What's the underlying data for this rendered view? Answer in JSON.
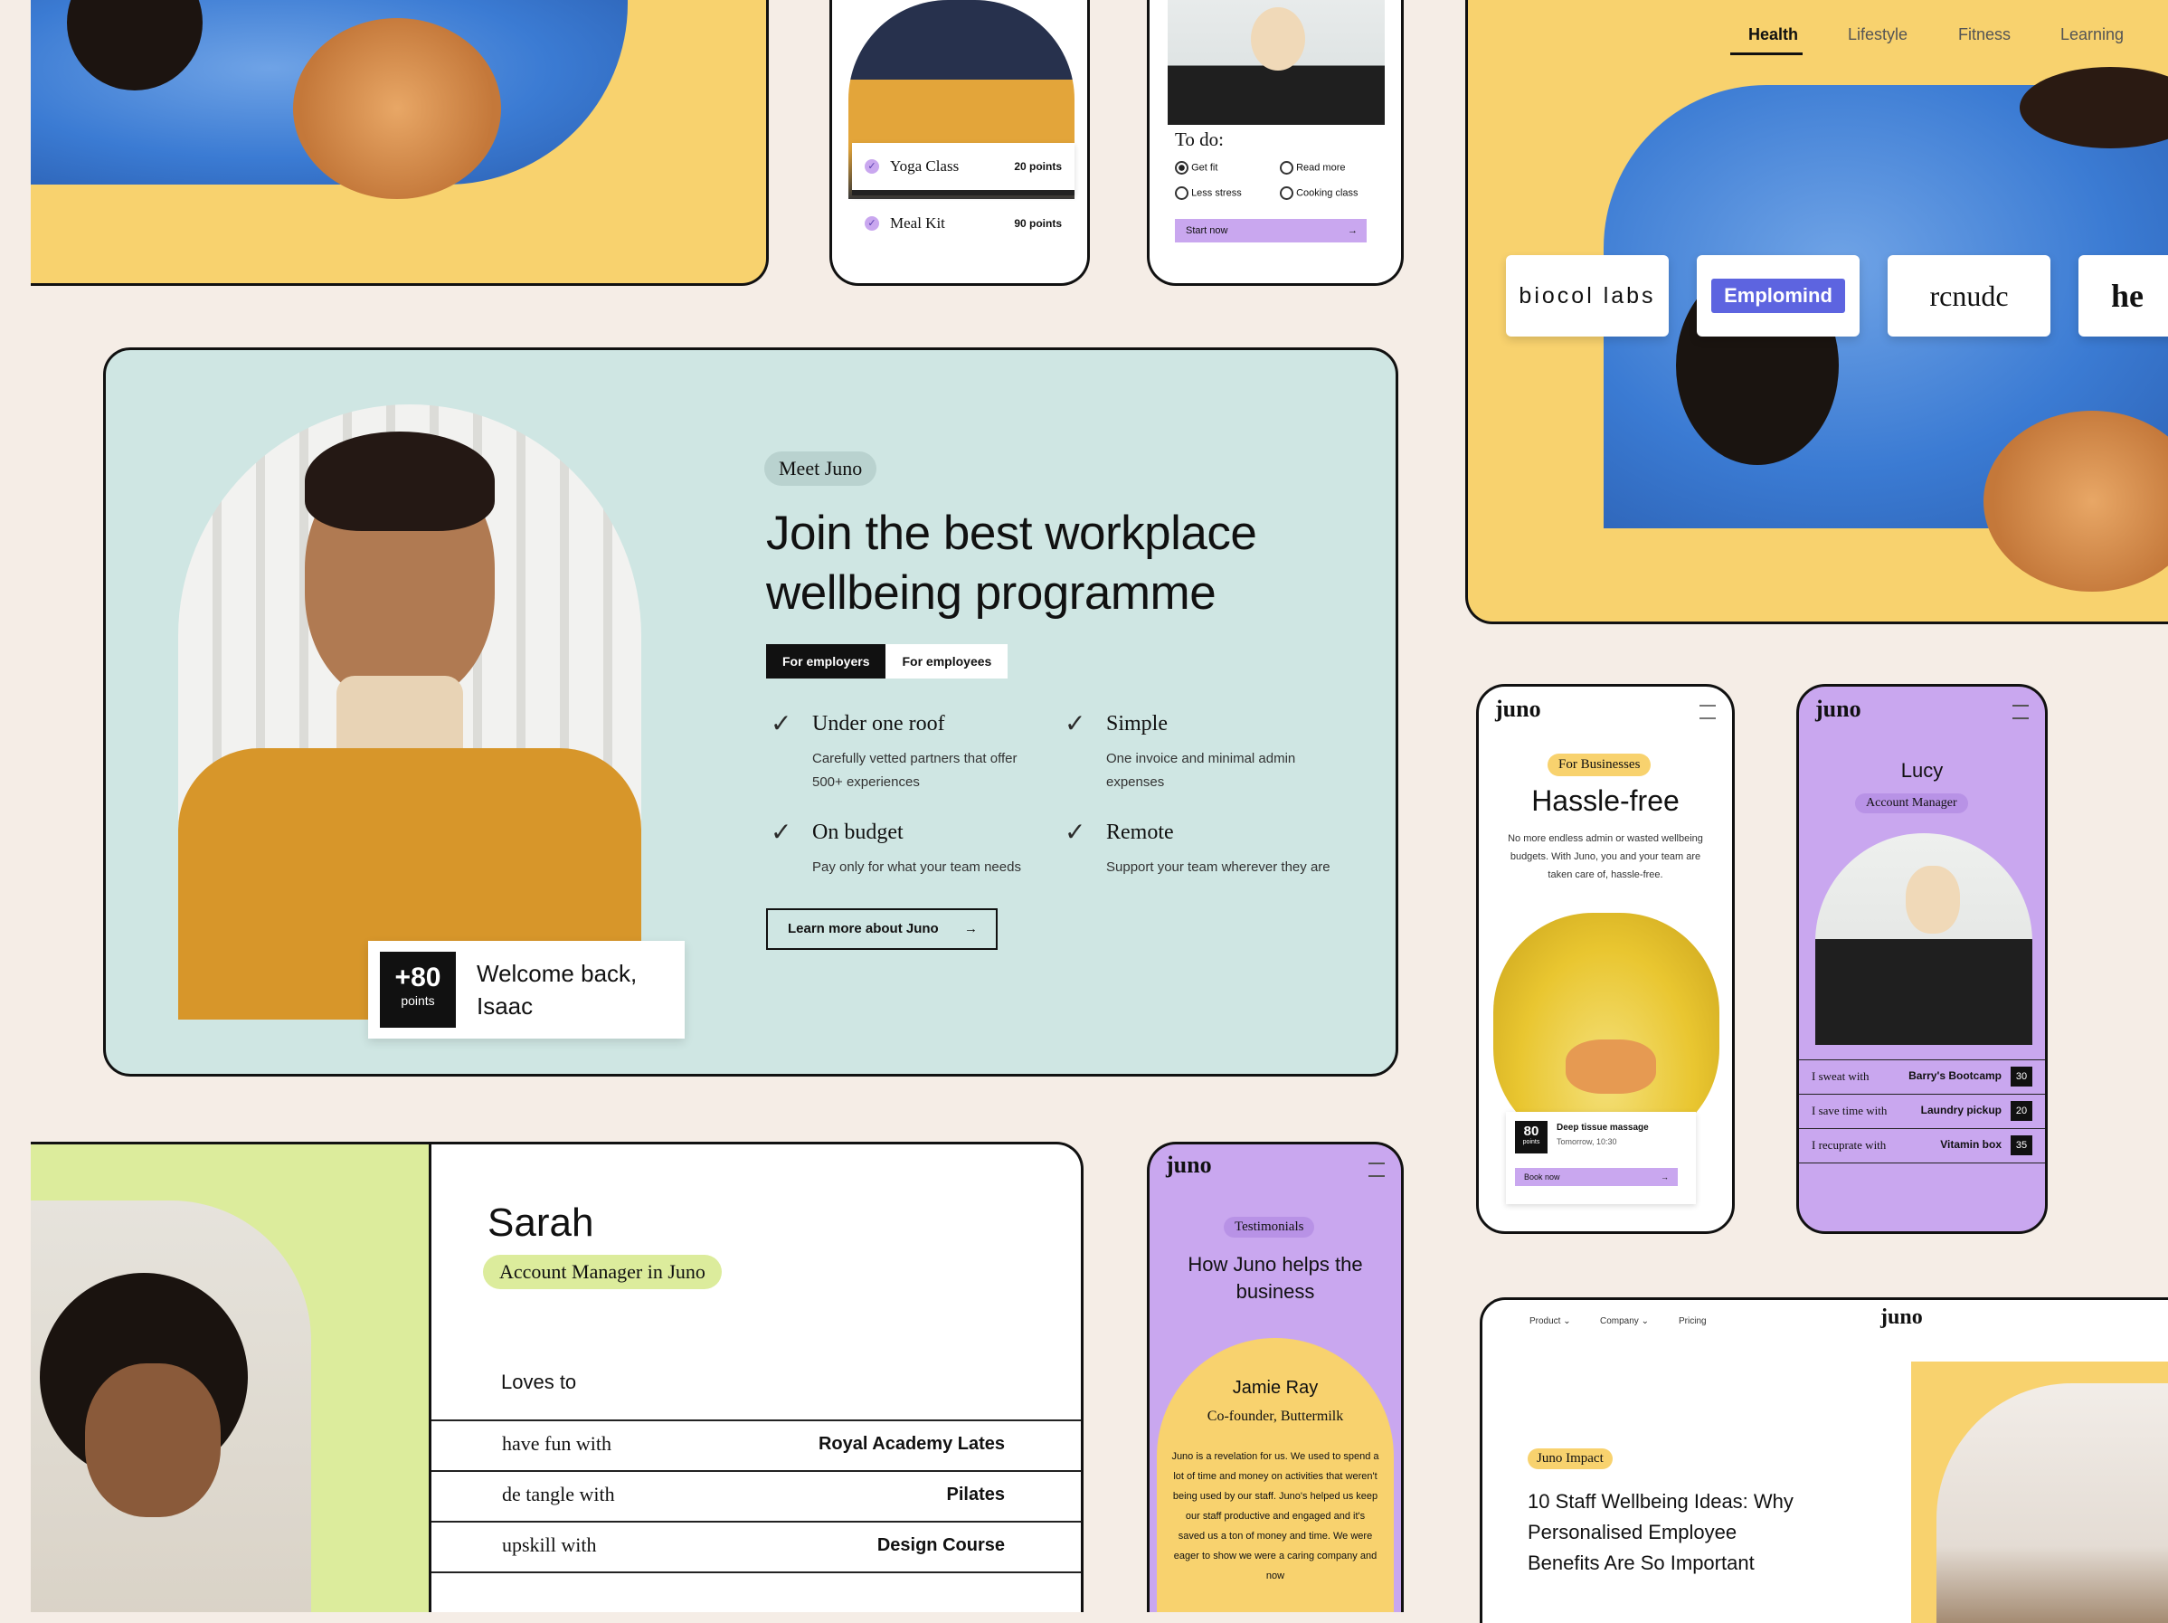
{
  "top_left_card": {
    "bg_color": "#f8d26e"
  },
  "yoga_phone": {
    "items": [
      {
        "label": "Yoga Class",
        "points": "20 points"
      },
      {
        "label": "Meal Kit",
        "points": "90 points"
      }
    ]
  },
  "todo_phone": {
    "title": "To do:",
    "options": [
      "Get fit",
      "Read more",
      "Less stress",
      "Cooking class"
    ],
    "button": "Start now"
  },
  "partners_card": {
    "tabs": [
      "Health",
      "Lifestyle",
      "Fitness",
      "Learning"
    ],
    "active_tab": "Health",
    "logos": [
      "biocol labs",
      "Emplomind",
      "rcnudc",
      "he"
    ]
  },
  "hero": {
    "badge": "Meet Juno",
    "headline_line1": "Join the best workplace",
    "headline_line2": "wellbeing programme",
    "toggle": [
      "For employers",
      "For employees"
    ],
    "features": [
      {
        "title": "Under one roof",
        "text": "Carefully vetted partners that offer 500+ experiences"
      },
      {
        "title": "Simple",
        "text": "One invoice and minimal admin expenses"
      },
      {
        "title": "On budget",
        "text": "Pay only for what your team needs"
      },
      {
        "title": "Remote",
        "text": "Support your team wherever they are"
      }
    ],
    "cta": "Learn more about Juno",
    "welcome_points": "+80",
    "welcome_points_label": "points",
    "welcome_line1": "Welcome back,",
    "welcome_line2": "Isaac",
    "bg_color": "#cfe6e3"
  },
  "business_phone": {
    "logo": "juno",
    "badge": "For Businesses",
    "title": "Hassle-free",
    "body": "No more endless admin or wasted wellbeing budgets. With Juno, you and your team are taken care of, hassle-free.",
    "points": "80",
    "points_label": "points",
    "booking_title": "Deep tissue massage",
    "booking_time": "Tomorrow, 10:30",
    "button": "Book now"
  },
  "lucy_phone": {
    "logo": "juno",
    "name": "Lucy",
    "role": "Account Manager",
    "rows": [
      {
        "label": "I sweat with",
        "value": "Barry's Bootcamp",
        "num": "30"
      },
      {
        "label": "I save time with",
        "value": "Laundry pickup",
        "num": "20"
      },
      {
        "label": "I recuprate with",
        "value": "Vitamin box",
        "num": "35"
      }
    ],
    "bg_color": "#c9a7ef"
  },
  "sarah_card": {
    "name": "Sarah",
    "role": "Account Manager in Juno",
    "loves_to": "Loves to",
    "rows": [
      {
        "label": "have fun with",
        "value": "Royal Academy Lates"
      },
      {
        "label": "de tangle with",
        "value": "Pilates"
      },
      {
        "label": "upskill with",
        "value": "Design Course"
      }
    ]
  },
  "testimonial_phone": {
    "logo": "juno",
    "badge": "Testimonials",
    "title": "How Juno helps the business",
    "person": "Jamie Ray",
    "person_role": "Co-founder, Buttermilk",
    "quote": "Juno is a revelation for us. We used to spend a lot of time and money on activities that weren't being used by our staff. Juno's helped us keep our staff productive and engaged and it's saved us a ton of money and time. We were eager to show we were a caring company and now"
  },
  "blog_card": {
    "nav": [
      "Product",
      "Company",
      "Pricing"
    ],
    "logo": "juno",
    "badge": "Juno Impact",
    "title_line1": "10 Staff Wellbeing Ideas: Why",
    "title_line2": "Personalised Employee",
    "title_line3": "Benefits Are So Important"
  }
}
